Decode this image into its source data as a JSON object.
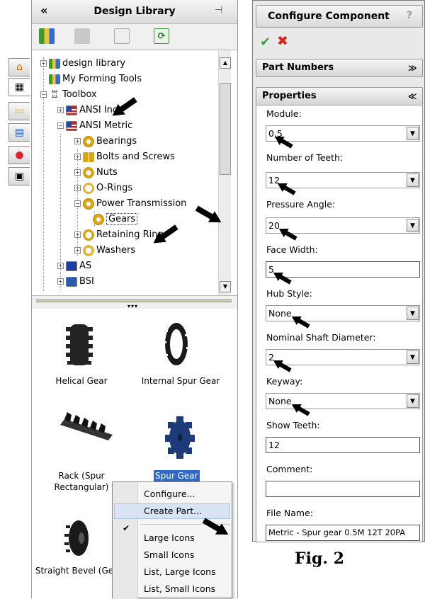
{
  "library": {
    "title": "Design Library",
    "collapse_glyph": "«",
    "pin_glyph": "⊣",
    "toolbar": [
      "add-to-library-icon",
      "add-file-location-icon",
      "create-new-folder-icon",
      "refresh-icon"
    ],
    "tree": {
      "items": [
        {
          "label": "design library",
          "icon": "library-icon"
        },
        {
          "label": "My Forming Tools",
          "icon": "library-icon"
        },
        {
          "label": "Toolbox",
          "icon": "toolbox-icon"
        },
        {
          "label": "ANSI Inch",
          "icon": "us-flag-icon"
        },
        {
          "label": "ANSI Metric",
          "icon": "us-flag-icon"
        },
        {
          "label": "Bearings",
          "icon": "bearing-icon"
        },
        {
          "label": "Bolts and Screws",
          "icon": "bolt-icon"
        },
        {
          "label": "Nuts",
          "icon": "nut-icon"
        },
        {
          "label": "O-Rings",
          "icon": "oring-icon"
        },
        {
          "label": "Power Transmission",
          "icon": "gear-icon"
        },
        {
          "label": "Gears",
          "icon": "gear-icon"
        },
        {
          "label": "Retaining Rings",
          "icon": "retaining-ring-icon"
        },
        {
          "label": "Washers",
          "icon": "washer-icon"
        },
        {
          "label": "AS",
          "icon": "australia-flag-icon"
        },
        {
          "label": "BSI",
          "icon": "uk-flag-icon"
        }
      ]
    },
    "gallery": [
      {
        "label": "Helical Gear"
      },
      {
        "label": "Internal Spur Gear"
      },
      {
        "label": "Rack (Spur\nRectangular)"
      },
      {
        "label": "Spur Gear"
      },
      {
        "label": "Straight Bevel (Ge"
      }
    ],
    "context_menu": [
      {
        "label": "Configure..."
      },
      {
        "label": "Create Part..."
      },
      {
        "label": "Large Icons",
        "checked": true
      },
      {
        "label": "Small Icons"
      },
      {
        "label": "List, Large Icons"
      },
      {
        "label": "List, Small Icons"
      }
    ],
    "side_tabs": [
      "home-icon",
      "design-library-icon",
      "file-explorer-icon",
      "view-palette-icon",
      "appearances-icon",
      "custom-properties-icon"
    ]
  },
  "configure": {
    "title": "Configure Component",
    "help_glyph": "?",
    "ok_glyph": "✔",
    "cancel_glyph": "✖",
    "part_numbers": {
      "title": "Part Numbers",
      "chevron": "≫"
    },
    "properties": {
      "title": "Properties",
      "chevron": "≪",
      "module": {
        "label": "Module:",
        "value": "0.5"
      },
      "teeth": {
        "label": "Number of Teeth:",
        "value": "12"
      },
      "pressure": {
        "label": "Pressure Angle:",
        "value": "20"
      },
      "face": {
        "label": "Face Width:",
        "value": "5"
      },
      "hub": {
        "label": "Hub Style:",
        "value": "None"
      },
      "shaft": {
        "label": "Nominal Shaft Diameter:",
        "value": "2"
      },
      "keyway": {
        "label": "Keyway:",
        "value": "None"
      },
      "show_teeth": {
        "label": "Show Teeth:",
        "value": "12"
      },
      "comment": {
        "label": "Comment:",
        "value": ""
      },
      "file_name": {
        "label": "File Name:",
        "value": "Metric - Spur gear 0.5M 12T 20PA"
      }
    }
  },
  "figure_caption": "Fig. 2"
}
